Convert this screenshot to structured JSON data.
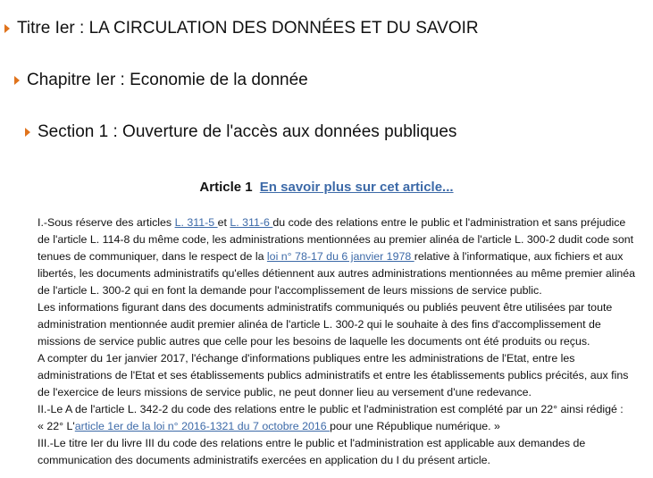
{
  "toc": {
    "titre": "Titre Ier : LA CIRCULATION DES DONNÉES ET DU SAVOIR",
    "chapitre": "Chapitre Ier : Economie de la donnée",
    "section": "Section 1 : Ouverture de l'accès aux données publiques"
  },
  "article": {
    "title": "Article 1",
    "more_link": "En savoir plus sur cet article...",
    "p1": {
      "t1": "I.-Sous réserve des articles ",
      "link1": "L. 311-5 ",
      "t2": "et ",
      "link2": "L. 311-6 ",
      "t3": "du code des relations entre le public et l'administration et sans préjudice de l'article L. 114-8 du même code, les administrations mentionnées au premier alinéa de l'article L. 300-2 dudit code sont tenues de communiquer, dans le respect de la ",
      "link3": "loi n° 78-17 du 6 janvier 1978 ",
      "t4": "relative à l'informatique, aux fichiers et aux libertés, les documents administratifs qu'elles détiennent aux autres administrations mentionnées au même premier alinéa de l'article L. 300-2 qui en font la demande pour l'accomplissement de leurs missions de service public."
    },
    "p2": "Les informations figurant dans des documents administratifs communiqués ou publiés peuvent être utilisées par toute administration mentionnée audit premier alinéa de l'article L. 300-2 qui le souhaite à des fins d'accomplissement de missions de service public autres que celle pour les besoins de laquelle les documents ont été produits ou reçus.",
    "p3": "A compter du 1er janvier 2017, l'échange d'informations publiques entre les administrations de l'Etat, entre les administrations de l'Etat et ses établissements publics administratifs et entre les établissements publics précités, aux fins de l'exercice de leurs missions de service public, ne peut donner lieu au versement d'une redevance.",
    "p4": "II.-Le A de l'article L. 342-2 du code des relations entre le public et l'administration est complété par un 22° ainsi rédigé :",
    "p5": {
      "t1": "« 22° L'",
      "link": "article 1er de la loi n° 2016-1321 du 7 octobre 2016 ",
      "t2": "pour une République numérique. »"
    },
    "p6": "III.-Le titre Ier du livre III du code des relations entre le public et l'administration est applicable aux demandes de communication des documents administratifs exercées en application du I du présent article."
  },
  "colors": {
    "arrow": "#e0731c",
    "link": "#3d6aa8",
    "text": "#111111"
  }
}
